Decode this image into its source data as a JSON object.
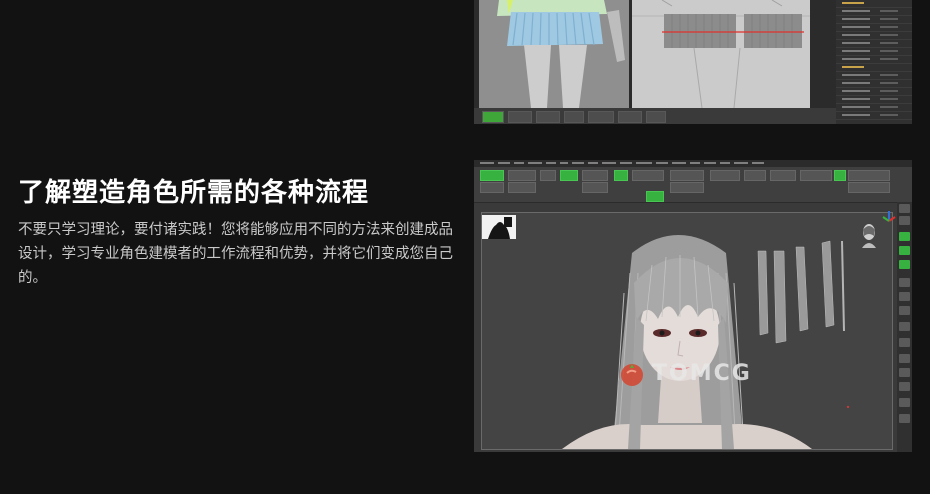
{
  "headline": "了解塑造角色所需的各种流程",
  "description": "不要只学习理论，要付诸实践！您将能够应用不同的方法来创建成品设计，学习专业角色建模者的工作流程和优势，并将它们变成您自己的。",
  "watermark": "TOMCG",
  "colors": {
    "background": "#121213",
    "accent_green": "#37b241",
    "accent_red": "#e0302d",
    "panel": "#303030",
    "canvas": "#444444"
  },
  "icons": [
    "tomato-logo-icon",
    "head-gizmo-icon",
    "axis-gizmo-icon"
  ]
}
